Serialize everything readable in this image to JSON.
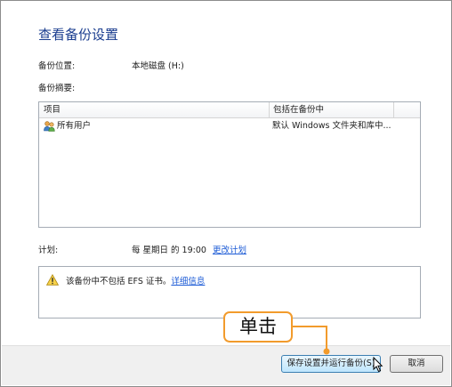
{
  "dialog": {
    "title": "查看备份设置",
    "backup_location_label": "备份位置:",
    "backup_location_value": "本地磁盘 (H:)",
    "backup_summary_label": "备份摘要:"
  },
  "list": {
    "columns": [
      "项目",
      "包括在备份中"
    ],
    "rows": [
      {
        "item": "所有用户",
        "included": "默认 Windows 文件夹和库中...",
        "icon": "users-icon"
      }
    ]
  },
  "schedule": {
    "label": "计划:",
    "value": "每 星期日 的 19:00",
    "change_link": "更改计划"
  },
  "warning": {
    "icon": "warning-icon",
    "text": "该备份中不包括 EFS 证书。",
    "details_link": "详细信息"
  },
  "buttons": {
    "save_run": "保存设置并运行备份(S)",
    "cancel": "取消"
  },
  "annotation": {
    "callout_text": "单击",
    "color": "#f29b2c"
  },
  "colors": {
    "title": "#1a3d8f",
    "link": "#1c5bd6",
    "footer": "#f0f0f0"
  }
}
